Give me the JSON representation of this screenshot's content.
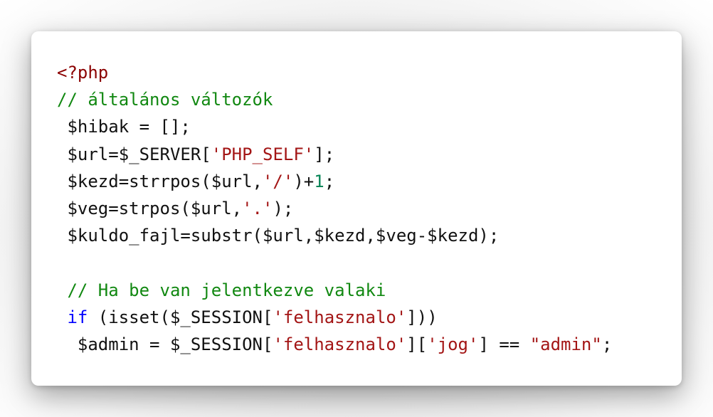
{
  "code": {
    "lines": [
      [
        {
          "t": "<?php",
          "c": "tag"
        }
      ],
      [
        {
          "t": "// általános változók",
          "c": "comment"
        }
      ],
      [
        {
          "t": " $hibak = [];",
          "c": "plain"
        }
      ],
      [
        {
          "t": " $url=$_SERVER[",
          "c": "plain"
        },
        {
          "t": "'PHP_SELF'",
          "c": "str"
        },
        {
          "t": "];",
          "c": "plain"
        }
      ],
      [
        {
          "t": " $kezd=strrpos($url,",
          "c": "plain"
        },
        {
          "t": "'/'",
          "c": "str"
        },
        {
          "t": ")+",
          "c": "plain"
        },
        {
          "t": "1",
          "c": "num"
        },
        {
          "t": ";",
          "c": "plain"
        }
      ],
      [
        {
          "t": " $veg=strpos($url,",
          "c": "plain"
        },
        {
          "t": "'.'",
          "c": "str"
        },
        {
          "t": ");",
          "c": "plain"
        }
      ],
      [
        {
          "t": " $kuldo_fajl=substr($url,$kezd,$veg-$kezd);",
          "c": "plain"
        }
      ],
      [
        {
          "t": "",
          "c": "plain"
        }
      ],
      [
        {
          "t": " // Ha be van jelentkezve valaki",
          "c": "comment"
        }
      ],
      [
        {
          "t": " ",
          "c": "plain"
        },
        {
          "t": "if",
          "c": "kw"
        },
        {
          "t": " (isset($_SESSION[",
          "c": "plain"
        },
        {
          "t": "'felhasznalo'",
          "c": "str"
        },
        {
          "t": "]))",
          "c": "plain"
        }
      ],
      [
        {
          "t": "  $admin = $_SESSION[",
          "c": "plain"
        },
        {
          "t": "'felhasznalo'",
          "c": "str"
        },
        {
          "t": "][",
          "c": "plain"
        },
        {
          "t": "'jog'",
          "c": "str"
        },
        {
          "t": "] == ",
          "c": "plain"
        },
        {
          "t": "\"admin\"",
          "c": "str"
        },
        {
          "t": ";",
          "c": "plain"
        }
      ]
    ]
  }
}
